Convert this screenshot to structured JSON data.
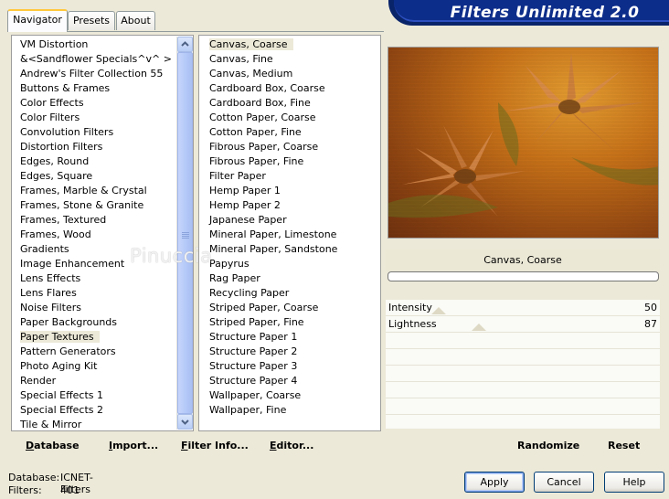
{
  "tabs": [
    {
      "label": "Navigator",
      "active": true
    },
    {
      "label": "Presets",
      "active": false
    },
    {
      "label": "About",
      "active": false
    }
  ],
  "title": "Filters Unlimited 2.0",
  "categories": {
    "selected": "Paper Textures",
    "items": [
      "VM Distortion",
      "&<Sandflower Specials^v^ >",
      "Andrew's Filter Collection 55",
      "Buttons & Frames",
      "Color Effects",
      "Color Filters",
      "Convolution Filters",
      "Distortion Filters",
      "Edges, Round",
      "Edges, Square",
      "Frames, Marble & Crystal",
      "Frames, Stone & Granite",
      "Frames, Textured",
      "Frames, Wood",
      "Gradients",
      "Image Enhancement",
      "Lens Effects",
      "Lens Flares",
      "Noise Filters",
      "Paper Backgrounds",
      "Paper Textures",
      "Pattern Generators",
      "Photo Aging Kit",
      "Render",
      "Special Effects 1",
      "Special Effects 2",
      "Tile & Mirror"
    ]
  },
  "filters": {
    "selected": "Canvas, Coarse",
    "items": [
      "Canvas, Coarse",
      "Canvas, Fine",
      "Canvas, Medium",
      "Cardboard Box, Coarse",
      "Cardboard Box, Fine",
      "Cotton Paper, Coarse",
      "Cotton Paper, Fine",
      "Fibrous Paper, Coarse",
      "Fibrous Paper, Fine",
      "Filter Paper",
      "Hemp Paper 1",
      "Hemp Paper 2",
      "Japanese Paper",
      "Mineral Paper, Limestone",
      "Mineral Paper, Sandstone",
      "Papyrus",
      "Rag Paper",
      "Recycling Paper",
      "Striped Paper, Coarse",
      "Striped Paper, Fine",
      "Structure Paper 1",
      "Structure Paper 2",
      "Structure Paper 3",
      "Structure Paper 4",
      "Wallpaper, Coarse",
      "Wallpaper, Fine"
    ]
  },
  "watermark": "Pinuccia",
  "preview": {
    "filter_name": "Canvas, Coarse",
    "progress": 0,
    "colors": {
      "light": "#e39a2b",
      "mid": "#c56d12",
      "dark": "#6b2c08",
      "petal": "#d88a4a",
      "leaf": "#6a6a18"
    }
  },
  "params": [
    {
      "label": "Intensity",
      "value": "50",
      "max": 255
    },
    {
      "label": "Lightness",
      "value": "87",
      "max": 255
    }
  ],
  "toolbar_left": [
    {
      "label": "Database",
      "key": "D"
    },
    {
      "label": "Import...",
      "key": "I"
    },
    {
      "label": "Filter Info...",
      "key": "F"
    },
    {
      "label": "Editor...",
      "key": "E"
    }
  ],
  "toolbar_right": {
    "randomize": "Randomize",
    "reset": "Reset"
  },
  "status": {
    "database_label": "Database:",
    "database_value": "ICNET-Filters",
    "filters_label": "Filters:",
    "filters_value": "401"
  },
  "buttons": {
    "apply": "Apply",
    "cancel": "Cancel",
    "help": "Help"
  }
}
